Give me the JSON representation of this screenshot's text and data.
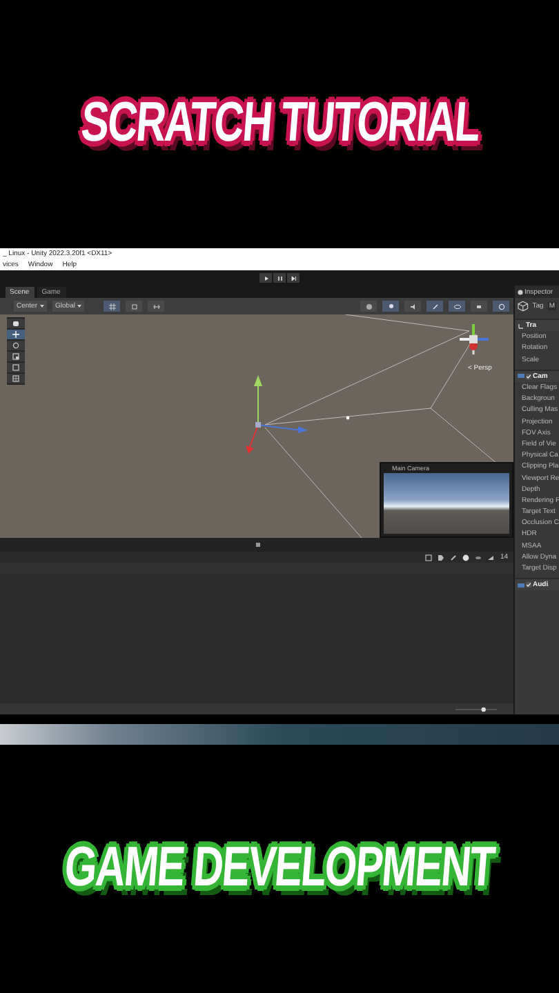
{
  "headlines": {
    "top": "SCRATCH TUTORIAL",
    "bottom": "GAME DEVELOPMENT"
  },
  "editor": {
    "window_title": "_ Linux - Unity 2022.3.20f1 <DX11>",
    "menu": [
      "vices",
      "Window",
      "Help"
    ],
    "tabs": [
      {
        "label": "Scene",
        "selected": true
      },
      {
        "label": "Game",
        "selected": false
      }
    ],
    "scene_toolbar": {
      "pivot": "Center",
      "space": "Global"
    },
    "tools": [
      {
        "kind": "hand",
        "selected": false
      },
      {
        "kind": "move",
        "selected": true
      },
      {
        "kind": "rotate",
        "selected": false
      },
      {
        "kind": "scale",
        "selected": false
      },
      {
        "kind": "rect",
        "selected": false
      },
      {
        "kind": "transform",
        "selected": false
      }
    ],
    "persp_label": "< Persp",
    "camera_preview": {
      "title": "Main Camera"
    },
    "stats_count": "14",
    "zoom_slider": {
      "level": 0.7
    },
    "inspector": {
      "title": "Inspector",
      "tag": "Tag",
      "tag_value": "M",
      "rows": [
        {
          "kind": "component",
          "label": "Tra"
        },
        {
          "kind": "property",
          "label": "Position"
        },
        {
          "kind": "property",
          "label": "Rotation"
        },
        {
          "kind": "property",
          "label": "Scale"
        },
        {
          "kind": "toggle_component",
          "label": "Cam",
          "checked": true
        },
        {
          "kind": "property",
          "label": "Clear Flags"
        },
        {
          "kind": "property",
          "label": "Backgroun"
        },
        {
          "kind": "property",
          "label": "Culling Mas"
        },
        {
          "kind": "property",
          "label": "Projection"
        },
        {
          "kind": "property",
          "label": "FOV Axis"
        },
        {
          "kind": "property",
          "label": "Field of Vie"
        },
        {
          "kind": "property",
          "label": "Physical Ca"
        },
        {
          "kind": "property",
          "label": "Clipping Pla"
        },
        {
          "kind": "property",
          "label": "Viewport Re"
        },
        {
          "kind": "property",
          "label": "Depth"
        },
        {
          "kind": "property",
          "label": "Rendering P"
        },
        {
          "kind": "property",
          "label": "Target Text"
        },
        {
          "kind": "property",
          "label": "Occlusion C"
        },
        {
          "kind": "property",
          "label": "HDR"
        },
        {
          "kind": "property",
          "label": "MSAA"
        },
        {
          "kind": "property",
          "label": "Allow Dyna"
        },
        {
          "kind": "property",
          "label": "Target Disp"
        },
        {
          "kind": "toggle_component",
          "label": "Audi",
          "checked": true
        }
      ]
    }
  }
}
